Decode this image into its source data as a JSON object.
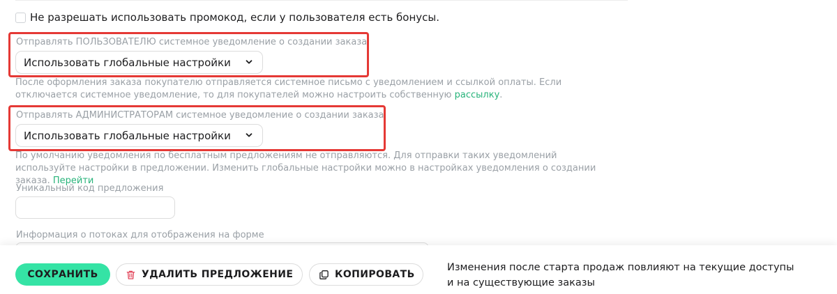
{
  "checkbox": {
    "label": "Не разрешать использовать промокод, если у пользователя есть бонусы.",
    "checked": false
  },
  "user_notification": {
    "label": "Отправлять ПОЛЬЗОВАТЕЛЮ системное уведомление о создании заказа",
    "selected": "Использовать глобальные настройки",
    "help_text": "После оформления заказа покупателю отправляется системное письмо с уведомлением и ссылкой оплаты. Если отключается системное уведомление, то для покупателей можно настроить собственную ",
    "help_link": "рассылку",
    "help_suffix": "."
  },
  "admin_notification": {
    "label": "Отправлять АДМИНИСТРАТОРАМ системное уведомление о создании заказа",
    "selected": "Использовать глобальные настройки",
    "help_text": "По умолчанию уведомления по бесплатным предложениям не отправляются. Для отправки таких уведомлений используйте настройки в предложении. Изменить глобальные настройки можно в настройках уведомления о создании заказа. ",
    "help_link": "Перейти"
  },
  "offer_code": {
    "label": "Уникальный код предложения",
    "value": ""
  },
  "streams_info": {
    "label": "Информация о потоках для отображения на форме"
  },
  "footer": {
    "save_label": "СОХРАНИТЬ",
    "delete_label": "УДАЛИТЬ ПРЕДЛОЖЕНИЕ",
    "copy_label": "КОПИРОВАТЬ",
    "notice_line1": "Изменения после старта продаж повлияют на текущие доступы",
    "notice_line2": "и на существующие заказы"
  },
  "icons": {
    "dropdown": "chevron-down-icon",
    "delete": "trash-icon",
    "copy": "copy-icon"
  },
  "colors": {
    "accent": "#35e3a5",
    "link": "#27b37a",
    "highlight": "#e53935",
    "delete_icon": "#e2455a"
  }
}
